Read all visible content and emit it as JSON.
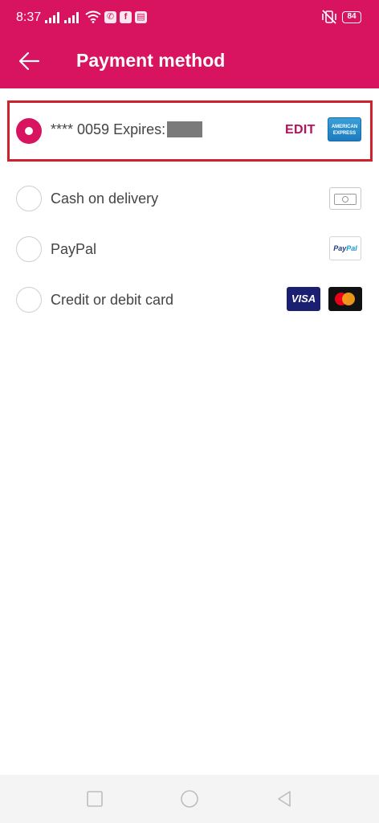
{
  "status_bar": {
    "time": "8:37",
    "battery": "84",
    "app_icons": [
      "viber-icon",
      "facebook-icon",
      "app-icon"
    ]
  },
  "app_bar": {
    "title": "Payment method",
    "back_icon": "arrow-left-icon",
    "color": "#d8135f"
  },
  "payment_methods": [
    {
      "label_number": "**** 0059",
      "label_expires": "Expires:",
      "expiry_masked": true,
      "action": "EDIT",
      "logo": "amex-logo",
      "logo_text": "AMERICAN EXPRESS",
      "selected": true
    },
    {
      "label": "Cash on delivery",
      "logo": "cash-icon",
      "selected": false
    },
    {
      "label": "PayPal",
      "logo": "paypal-logo",
      "logo_text": "PayPal",
      "selected": false
    },
    {
      "label": "Credit or debit card",
      "logos": [
        "visa-logo",
        "mastercard-logo"
      ],
      "visa_text": "VISA",
      "selected": false
    }
  ],
  "nav_bar": {
    "buttons": [
      "recents-icon",
      "home-icon",
      "back-icon"
    ]
  },
  "colors": {
    "accent": "#d8135f",
    "highlight_border": "#d0202c"
  }
}
